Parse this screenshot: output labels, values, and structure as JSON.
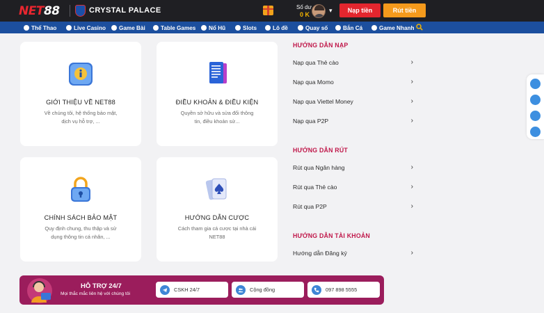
{
  "header": {
    "logo_net": "NET",
    "logo_88": "88",
    "partner_name": "CRYSTAL PALACE",
    "balance_label": "Số dư",
    "balance_value": "0 K",
    "deposit_label": "Nạp tiền",
    "withdraw_label": "Rút tiền"
  },
  "nav": {
    "items": [
      {
        "label": "Thể Thao"
      },
      {
        "label": "Live Casino"
      },
      {
        "label": "Game Bài"
      },
      {
        "label": "Table Games"
      },
      {
        "label": "Nổ Hũ"
      },
      {
        "label": "Slots"
      },
      {
        "label": "Lô đề"
      },
      {
        "label": "Quay số"
      },
      {
        "label": "Bắn Cá"
      },
      {
        "label": "Game Nhanh"
      }
    ]
  },
  "cards": [
    {
      "title": "GIỚI THIỆU VỀ NET88",
      "desc": "Về chúng tôi, hệ thống bảo mật, dịch vụ hỗ trợ, ..."
    },
    {
      "title": "ĐIỀU KHOẢN & ĐIỀU KIỆN",
      "desc": "Quyền sở hữu và sửa đổi thông tin, điều khoản sử..."
    },
    {
      "title": "CHÍNH SÁCH BẢO MẬT",
      "desc": "Quy định chung, thu thập và sử dụng thông tin cá nhân, ..."
    },
    {
      "title": "HƯỚNG DẪN CƯỢC",
      "desc": "Cách tham gia cá cược tại nhà cái NET88"
    }
  ],
  "guides": {
    "deposit_title": "HƯỚNG DẪN NẠP",
    "deposit_items": [
      "Nạp qua Thẻ cào",
      "Nạp qua Momo",
      "Nạp qua Viettel Money",
      "Nạp qua P2P"
    ],
    "withdraw_title": "HƯỚNG DẪN RÚT",
    "withdraw_items": [
      "Rút qua Ngân hàng",
      "Rút qua Thẻ cào",
      "Rút qua P2P"
    ],
    "account_title": "HƯỚNG DẪN TÀI KHOẢN",
    "account_items": [
      "Hướng dẫn Đăng ký"
    ],
    "arrow": "›"
  },
  "support": {
    "title": "HỖ TRỢ 24/7",
    "subtitle": "Mọi thắc mắc liên hệ với chúng tôi",
    "buttons": [
      "CSKH 24/7",
      "Cộng đồng",
      "097 898 5555"
    ]
  },
  "colors": {
    "topbar": "#1f1f23",
    "navbar": "#1c4f9e",
    "deposit_button": "#e3262e",
    "withdraw_button": "#f59a1c",
    "guide_heading": "#c0184a",
    "support_banner": "#9b1d5c"
  }
}
